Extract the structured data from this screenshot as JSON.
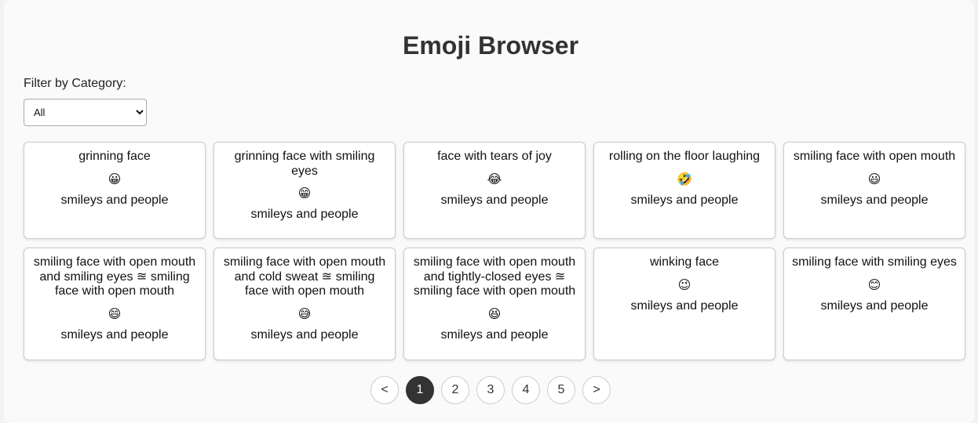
{
  "page": {
    "title": "Emoji Browser"
  },
  "filter": {
    "label": "Filter by Category:",
    "selected": "All"
  },
  "cards": [
    {
      "name": "grinning face",
      "emoji": "😀",
      "category": "smileys and people"
    },
    {
      "name": "grinning face with smiling eyes",
      "emoji": "😁",
      "category": "smileys and people"
    },
    {
      "name": "face with tears of joy",
      "emoji": "😂",
      "category": "smileys and people"
    },
    {
      "name": "rolling on the floor laughing",
      "emoji": "🤣",
      "category": "smileys and people"
    },
    {
      "name": "smiling face with open mouth",
      "emoji": "😃",
      "category": "smileys and people"
    },
    {
      "name": "smiling face with open mouth and smiling eyes ≊ smiling face with open mouth",
      "emoji": "😄",
      "category": "smileys and people"
    },
    {
      "name": "smiling face with open mouth and cold sweat ≊ smiling face with open mouth",
      "emoji": "😅",
      "category": "smileys and people"
    },
    {
      "name": "smiling face with open mouth and tightly-closed eyes ≊ smiling face with open mouth",
      "emoji": "😆",
      "category": "smileys and people"
    },
    {
      "name": "winking face",
      "emoji": "😉",
      "category": "smileys and people"
    },
    {
      "name": "smiling face with smiling eyes",
      "emoji": "😊",
      "category": "smileys and people"
    }
  ],
  "pagination": {
    "prev": "<",
    "next": ">",
    "pages": [
      "1",
      "2",
      "3",
      "4",
      "5"
    ],
    "current": "1"
  },
  "colors": {
    "active_page": "#333333",
    "card_border": "#cccccc",
    "background": "#fafafa"
  }
}
